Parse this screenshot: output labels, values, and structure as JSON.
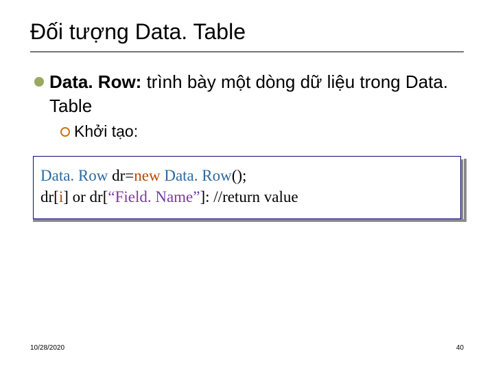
{
  "title": "Đối tượng Data. Table",
  "bullet": {
    "strong": "Data. Row:",
    "text": " trình bày một dòng dữ liệu trong Data. Table"
  },
  "sub": {
    "text": "Khởi tạo:"
  },
  "code": {
    "line1_type1": "Data. Row",
    "line1_mid": " dr=",
    "line1_new": "new",
    "line1_type2": " Data. Row",
    "line1_end": "();",
    "line2_a": "dr[",
    "line2_i": "i",
    "line2_b": "] or dr[",
    "line2_str": "“Field. Name”",
    "line2_c": "]: //return value"
  },
  "footer": {
    "date": "10/28/2020",
    "page": "40"
  }
}
